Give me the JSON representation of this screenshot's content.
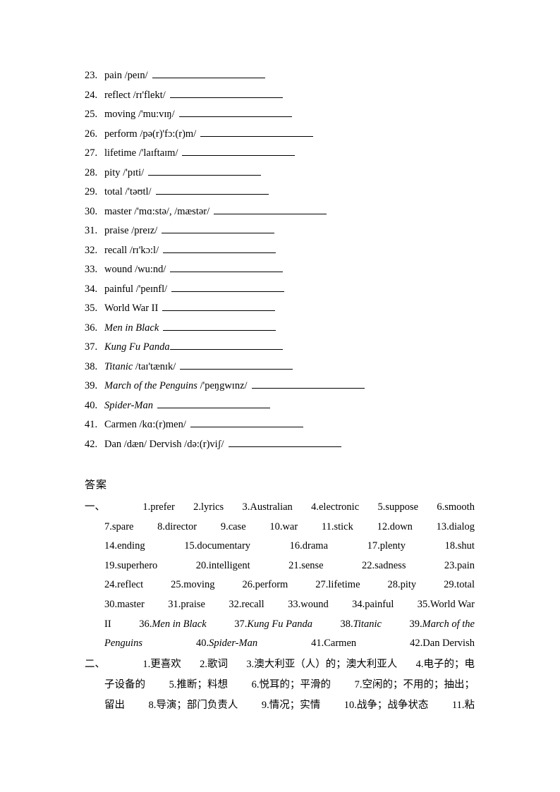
{
  "vocab": [
    {
      "num": "23.",
      "word": "pain",
      "italic": false,
      "ipa": "/peɪn/"
    },
    {
      "num": "24.",
      "word": "reflect",
      "italic": false,
      "ipa": "/rɪ'flekt/"
    },
    {
      "num": "25.",
      "word": "moving",
      "italic": false,
      "ipa": "/'mu:vɪŋ/"
    },
    {
      "num": "26.",
      "word": "perform",
      "italic": false,
      "ipa": "/pə(r)'fɔ:(r)m/"
    },
    {
      "num": "27.",
      "word": "lifetime",
      "italic": false,
      "ipa": "/'laɪftaɪm/"
    },
    {
      "num": "28.",
      "word": "pity",
      "italic": false,
      "ipa": "/'pɪti/"
    },
    {
      "num": "29.",
      "word": "total",
      "italic": false,
      "ipa": "/'təʊtl/"
    },
    {
      "num": "30.",
      "word": "master",
      "italic": false,
      "ipa": "/'mɑ:stə/, /mæstər/"
    },
    {
      "num": "31.",
      "word": "praise",
      "italic": false,
      "ipa": "/preɪz/"
    },
    {
      "num": "32.",
      "word": "recall",
      "italic": false,
      "ipa": "/rɪ'kɔ:l/"
    },
    {
      "num": "33.",
      "word": "wound",
      "italic": false,
      "ipa": "/wu:nd/"
    },
    {
      "num": "34.",
      "word": "painful",
      "italic": false,
      "ipa": "/'peɪnfl/"
    },
    {
      "num": "35.",
      "word": "World War II",
      "italic": false,
      "ipa": ""
    },
    {
      "num": "36.",
      "word": "Men in Black",
      "italic": true,
      "ipa": ""
    },
    {
      "num": "37.",
      "word": "Kung Fu Panda",
      "italic": true,
      "ipa": "",
      "tight": true
    },
    {
      "num": "38.",
      "word": "Titanic",
      "italic": true,
      "ipa": "/taɪ'tænɪk/"
    },
    {
      "num": "39.",
      "word": "March of the Penguins",
      "italic": true,
      "ipa": "/'peŋgwɪnz/"
    },
    {
      "num": "40.",
      "word": "Spider-Man",
      "italic": true,
      "ipa": ""
    },
    {
      "num": "41.",
      "word": "Carmen",
      "italic": false,
      "ipa": "/kɑ:(r)men/"
    },
    {
      "num": "42.",
      "word": "Dan /dæn/ Dervish",
      "italic": false,
      "ipa": "/də:(r)viʃ/"
    }
  ],
  "answers": {
    "heading": "答案",
    "section1": {
      "marker": "一、",
      "lines": [
        [
          {
            "t": "1.prefer"
          },
          {
            "t": "2.lyrics"
          },
          {
            "t": "3.Australian"
          },
          {
            "t": "4.electronic"
          },
          {
            "t": "5.suppose"
          },
          {
            "t": "6.smooth"
          }
        ],
        [
          {
            "t": "7.spare"
          },
          {
            "t": "8.director"
          },
          {
            "t": "9.case"
          },
          {
            "t": "10.war"
          },
          {
            "t": "11.stick"
          },
          {
            "t": "12.down"
          },
          {
            "t": "13.dialog"
          }
        ],
        [
          {
            "t": "14.ending"
          },
          {
            "t": "15.documentary"
          },
          {
            "t": "16.drama"
          },
          {
            "t": "17.plenty"
          },
          {
            "t": "18.shut"
          }
        ],
        [
          {
            "t": "19.superhero"
          },
          {
            "t": "20.intelligent"
          },
          {
            "t": "21.sense"
          },
          {
            "t": "22.sadness"
          },
          {
            "t": "23.pain"
          }
        ],
        [
          {
            "t": "24.reflect"
          },
          {
            "t": "25.moving"
          },
          {
            "t": "26.perform"
          },
          {
            "t": "27.lifetime"
          },
          {
            "t": "28.pity"
          },
          {
            "t": "29.total"
          }
        ],
        [
          {
            "t": "30.master"
          },
          {
            "t": "31.praise"
          },
          {
            "t": "32.recall"
          },
          {
            "t": "33.wound"
          },
          {
            "t": "34.painful"
          },
          {
            "t": "35.World War"
          }
        ],
        [
          {
            "t": "II"
          },
          {
            "t": "36.",
            "i": "Men in Black"
          },
          {
            "t": "37.",
            "i": "Kung Fu Panda"
          },
          {
            "t": "38.",
            "i": "Titanic"
          },
          {
            "t": "39.",
            "i": "March of the"
          }
        ],
        [
          {
            "i": "Penguins"
          },
          {
            "t": "40.",
            "i": "Spider-Man"
          },
          {
            "t": "41.Carmen"
          },
          {
            "t": "42.Dan Dervish"
          }
        ]
      ]
    },
    "section2": {
      "marker": "二、",
      "lines": [
        [
          {
            "n": "1.",
            "t": "更喜欢"
          },
          {
            "n": "2.",
            "t": "歌词"
          },
          {
            "n": "3.",
            "t": "澳大利亚（人）的；澳大利亚人"
          },
          {
            "n": "4.",
            "t": "电子的；电"
          }
        ],
        [
          {
            "t": "子设备的"
          },
          {
            "n": "5.",
            "t": "推断；料想"
          },
          {
            "n": "6.",
            "t": "悦耳的；平滑的"
          },
          {
            "n": "7.",
            "t": "空闲的；不用的；抽出；"
          }
        ],
        [
          {
            "t": "留出"
          },
          {
            "n": "8.",
            "t": "导演；部门负责人"
          },
          {
            "n": "9.",
            "t": "情况；实情"
          },
          {
            "n": "10.",
            "t": "战争；战争状态"
          },
          {
            "n": "11.",
            "t": "粘"
          }
        ]
      ]
    }
  }
}
